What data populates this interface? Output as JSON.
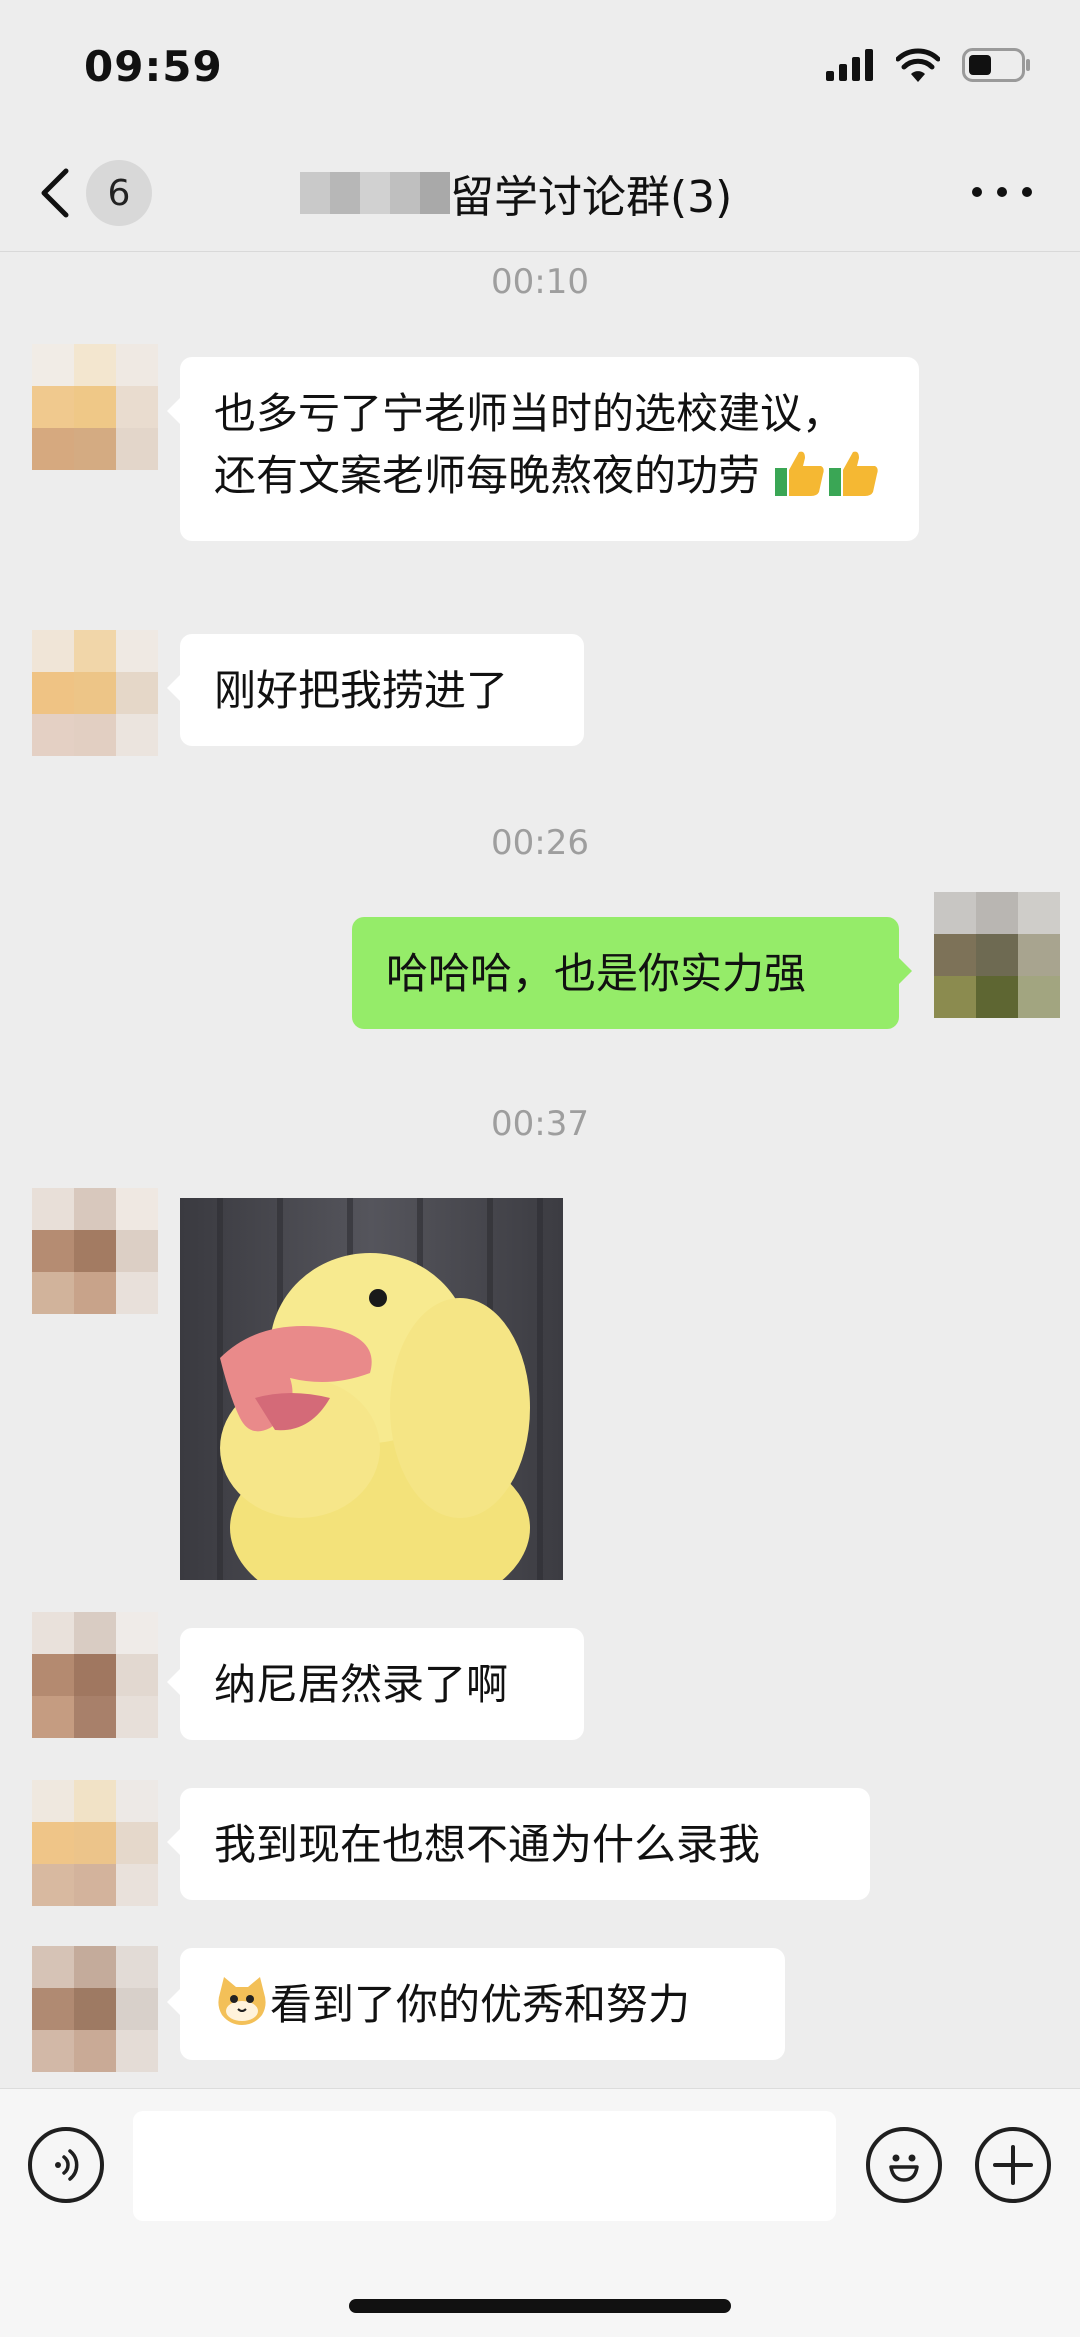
{
  "status_bar": {
    "time": "09:59",
    "icons": [
      "signal-icon",
      "wifi-icon",
      "battery-icon"
    ]
  },
  "nav": {
    "back_count": "6",
    "title": "留学讨论群(3)",
    "more_icon": "more-icon"
  },
  "messages": {
    "ts1": "00:10",
    "m1": "也多亏了宁老师当时的选校建议，还有文案老师每晚熬夜的功劳",
    "m2": "刚好把我捞进了",
    "ts2": "00:26",
    "m3": "哈哈哈，也是你实力强",
    "ts3": "00:37",
    "sticker": "duck-sticker",
    "m4": "纳尼居然录了啊",
    "m5": "我到现在也想不通为什么录我",
    "m6": "看到了你的优秀和努力"
  },
  "input_bar": {
    "voice_icon": "voice-icon",
    "emoji_icon": "emoji-icon",
    "plus_icon": "plus-icon"
  },
  "colors": {
    "background": "#ededed",
    "my_bubble": "#95ec69",
    "their_bubble": "#ffffff",
    "timestamp": "#9e9e9e"
  }
}
